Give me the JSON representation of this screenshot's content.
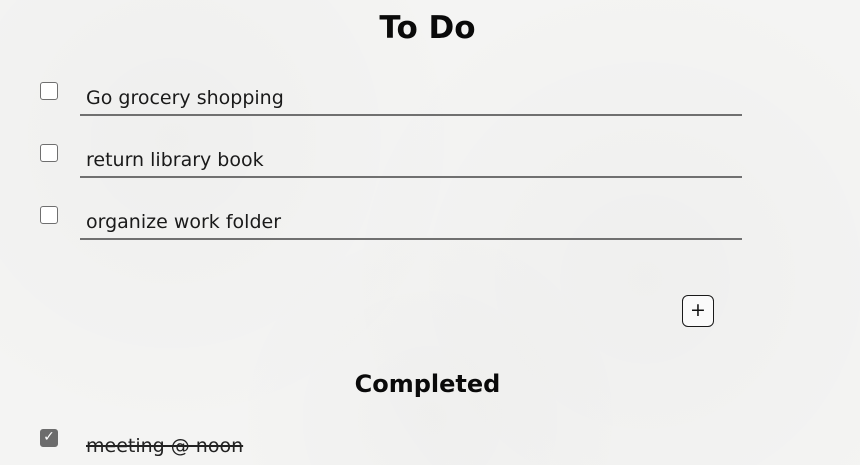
{
  "page": {
    "title": "To Do",
    "completed_title": "Completed"
  },
  "todo_items": [
    {
      "text": "Go grocery shopping",
      "checked": false
    },
    {
      "text": "return library book",
      "checked": false
    },
    {
      "text": "organize work folder",
      "checked": false
    }
  ],
  "add_button": {
    "icon": "plus-icon",
    "symbol": "+"
  },
  "completed_items": [
    {
      "text": "meeting @ noon",
      "checked": true,
      "check_symbol": "✓"
    }
  ],
  "colors": {
    "background": "#f4f4f3",
    "text": "#111111",
    "underline": "#707070",
    "checkbox_checked": "#6c6c6c"
  }
}
